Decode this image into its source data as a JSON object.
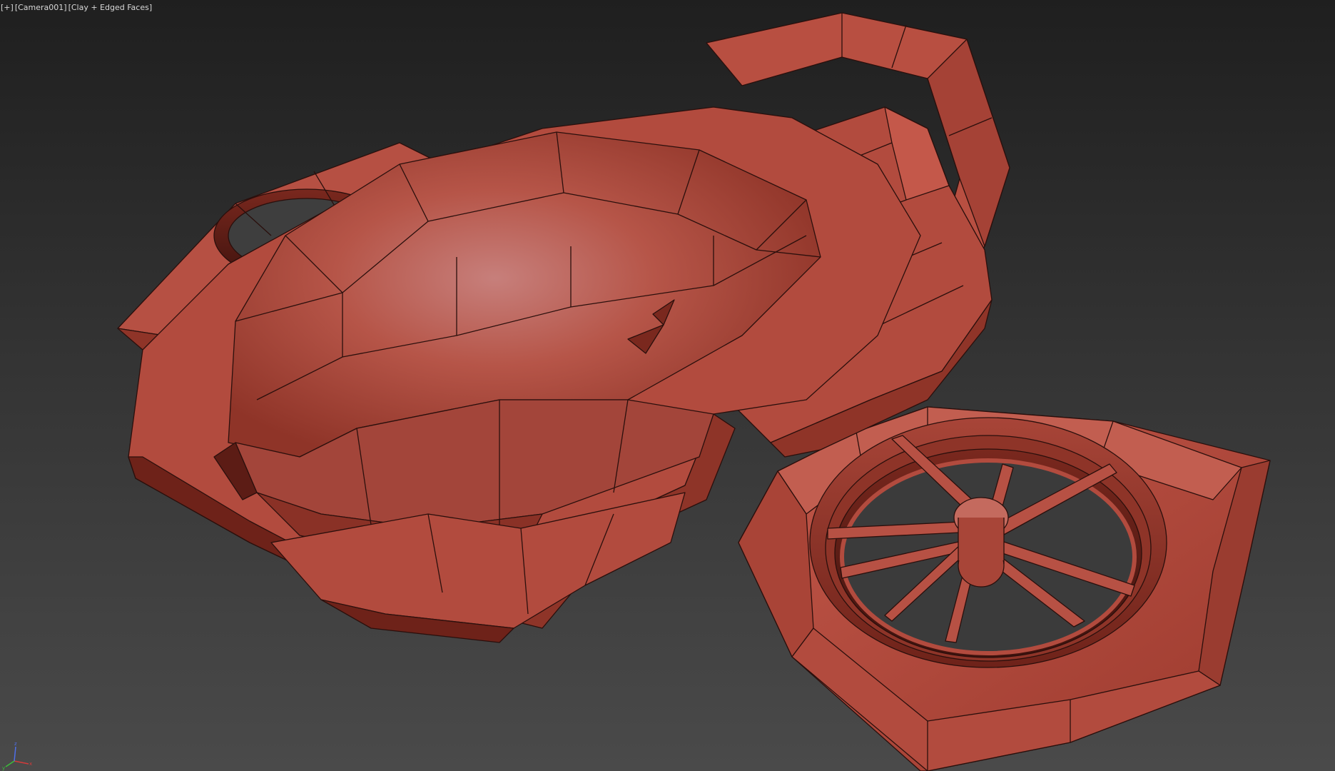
{
  "viewport": {
    "labels": {
      "plus": "[+]",
      "camera": "[Camera001]",
      "shading": "[Clay + Edged Faces]"
    },
    "clay_color": "#b8493c",
    "edge_color": "#2a0f0c",
    "background_top": "#1f1f1f",
    "background_bottom": "#4a4a4a",
    "model": "hover-drone-mesh",
    "gizmo": {
      "x_label": "x",
      "y_label": "y",
      "z_label": "z",
      "x_color": "#d23b3b",
      "y_color": "#3bbf3b",
      "z_color": "#4f6fe8"
    }
  }
}
